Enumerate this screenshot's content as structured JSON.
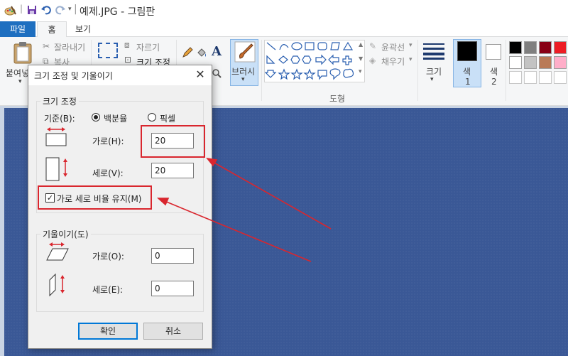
{
  "titlebar": {
    "separator": "|",
    "title": "예제.JPG - 그림판"
  },
  "tabs": {
    "file": "파일",
    "home": "홈",
    "view": "보기"
  },
  "ribbon": {
    "clipboard": {
      "paste": "붙여넣",
      "cut": "잘라내기",
      "copy": "복사"
    },
    "image": {
      "crop": "자르기",
      "resize": "크기 조정"
    },
    "brushes": "브러시",
    "shapes": {
      "outline": "윤곽선",
      "fill": "채우기",
      "group_label": "도형"
    },
    "size": "크기",
    "color1": {
      "line1": "색",
      "line2": "1"
    },
    "color2": {
      "line1": "색",
      "line2": "2"
    },
    "accent": "#1e6fc0",
    "palette_row1": [
      "#000000",
      "#7f7f7f",
      "#880015",
      "#ed1c24"
    ],
    "palette_row2": [
      "#ffffff",
      "#c3c3c3",
      "#b97a57",
      "#ffaec9"
    ]
  },
  "dialog": {
    "title": "크기 조정 및 기울이기",
    "close_glyph": "✕",
    "resize": {
      "group_title": "크기 조정",
      "basis_label": "기준(B):",
      "option_percent": "백분율",
      "option_pixel": "픽셀",
      "selected": "백분율",
      "horizontal_label": "가로(H):",
      "horizontal_value": "20",
      "vertical_label": "세로(V):",
      "vertical_value": "20",
      "keep_ratio_label": "가로 세로 비율 유지(M)",
      "keep_ratio_checked": true
    },
    "skew": {
      "group_title": "기울이기(도)",
      "horizontal_label": "가로(O):",
      "horizontal_value": "0",
      "vertical_label": "세로(E):",
      "vertical_value": "0"
    },
    "ok": "확인",
    "cancel": "취소"
  },
  "annotation_color": "#d9262e"
}
